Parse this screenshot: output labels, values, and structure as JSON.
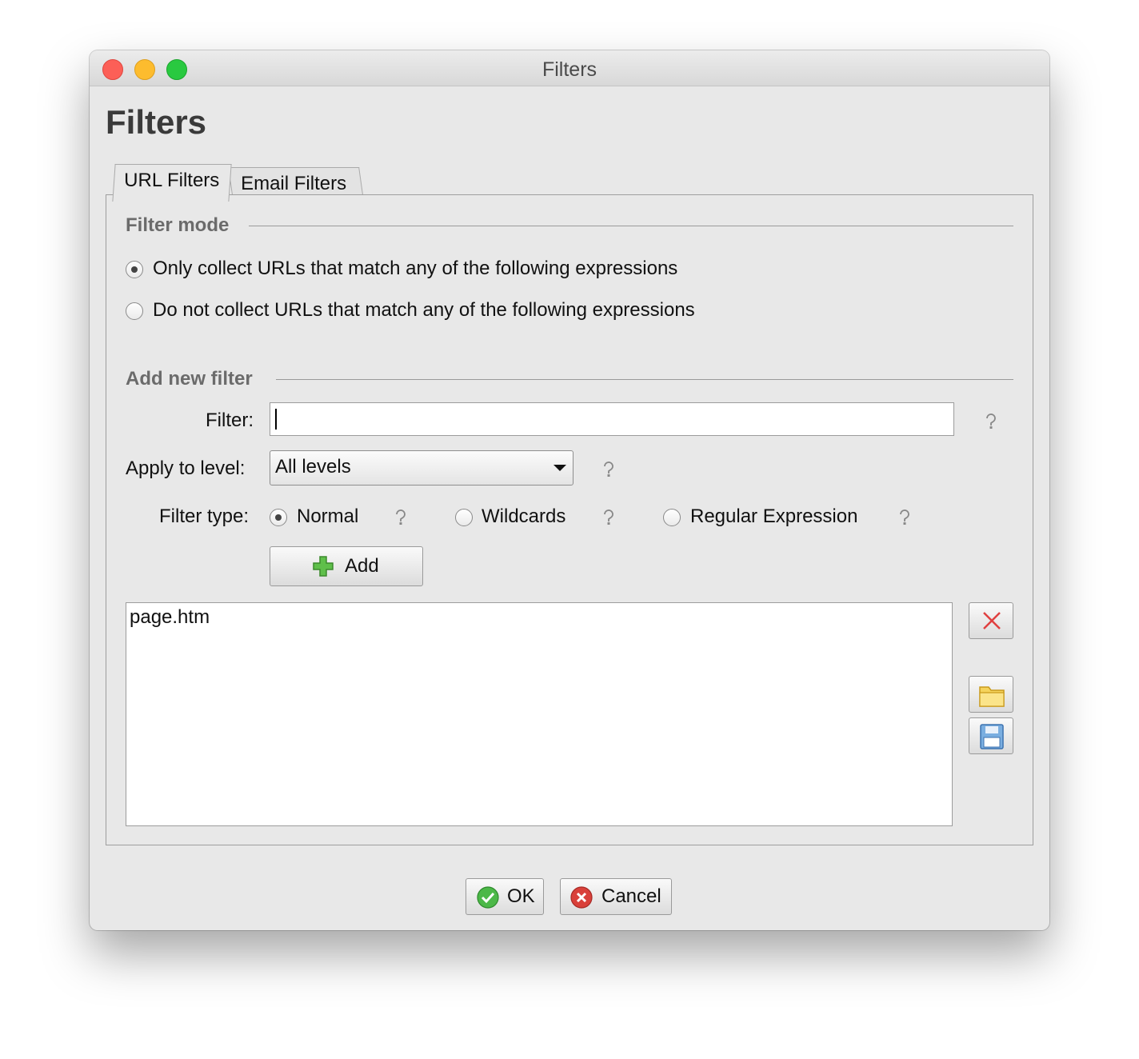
{
  "window": {
    "title": "Filters",
    "heading": "Filters"
  },
  "tabs": [
    {
      "label": "URL Filters",
      "selected": true
    },
    {
      "label": "Email Filters",
      "selected": false
    }
  ],
  "filter_mode": {
    "title": "Filter mode",
    "options": [
      {
        "label": "Only collect URLs that match any of the following expressions",
        "selected": true
      },
      {
        "label": "Do not collect URLs that match any of the following expressions",
        "selected": false
      }
    ]
  },
  "add_filter": {
    "title": "Add new filter",
    "filter_label": "Filter:",
    "filter_value": "",
    "level_label": "Apply to level:",
    "level_value": "All levels",
    "type_label": "Filter type:",
    "types": [
      {
        "label": "Normal",
        "selected": true
      },
      {
        "label": "Wildcards",
        "selected": false
      },
      {
        "label": "Regular Expression",
        "selected": false
      }
    ],
    "add_label": "Add"
  },
  "filters_list": [
    "page.htm"
  ],
  "footer": {
    "ok_label": "OK",
    "cancel_label": "Cancel"
  },
  "colors": {
    "close": "#fc5f57",
    "minimize": "#fdbc2e",
    "maximize": "#29c940",
    "delete_icon": "#e04040",
    "ok_icon": "#4cb848",
    "cancel_icon": "#d9403a"
  },
  "icons": {
    "help": "question-mark-icon",
    "add": "green-plus-icon",
    "delete": "red-x-icon",
    "open": "folder-icon",
    "save": "floppy-disk-icon"
  }
}
